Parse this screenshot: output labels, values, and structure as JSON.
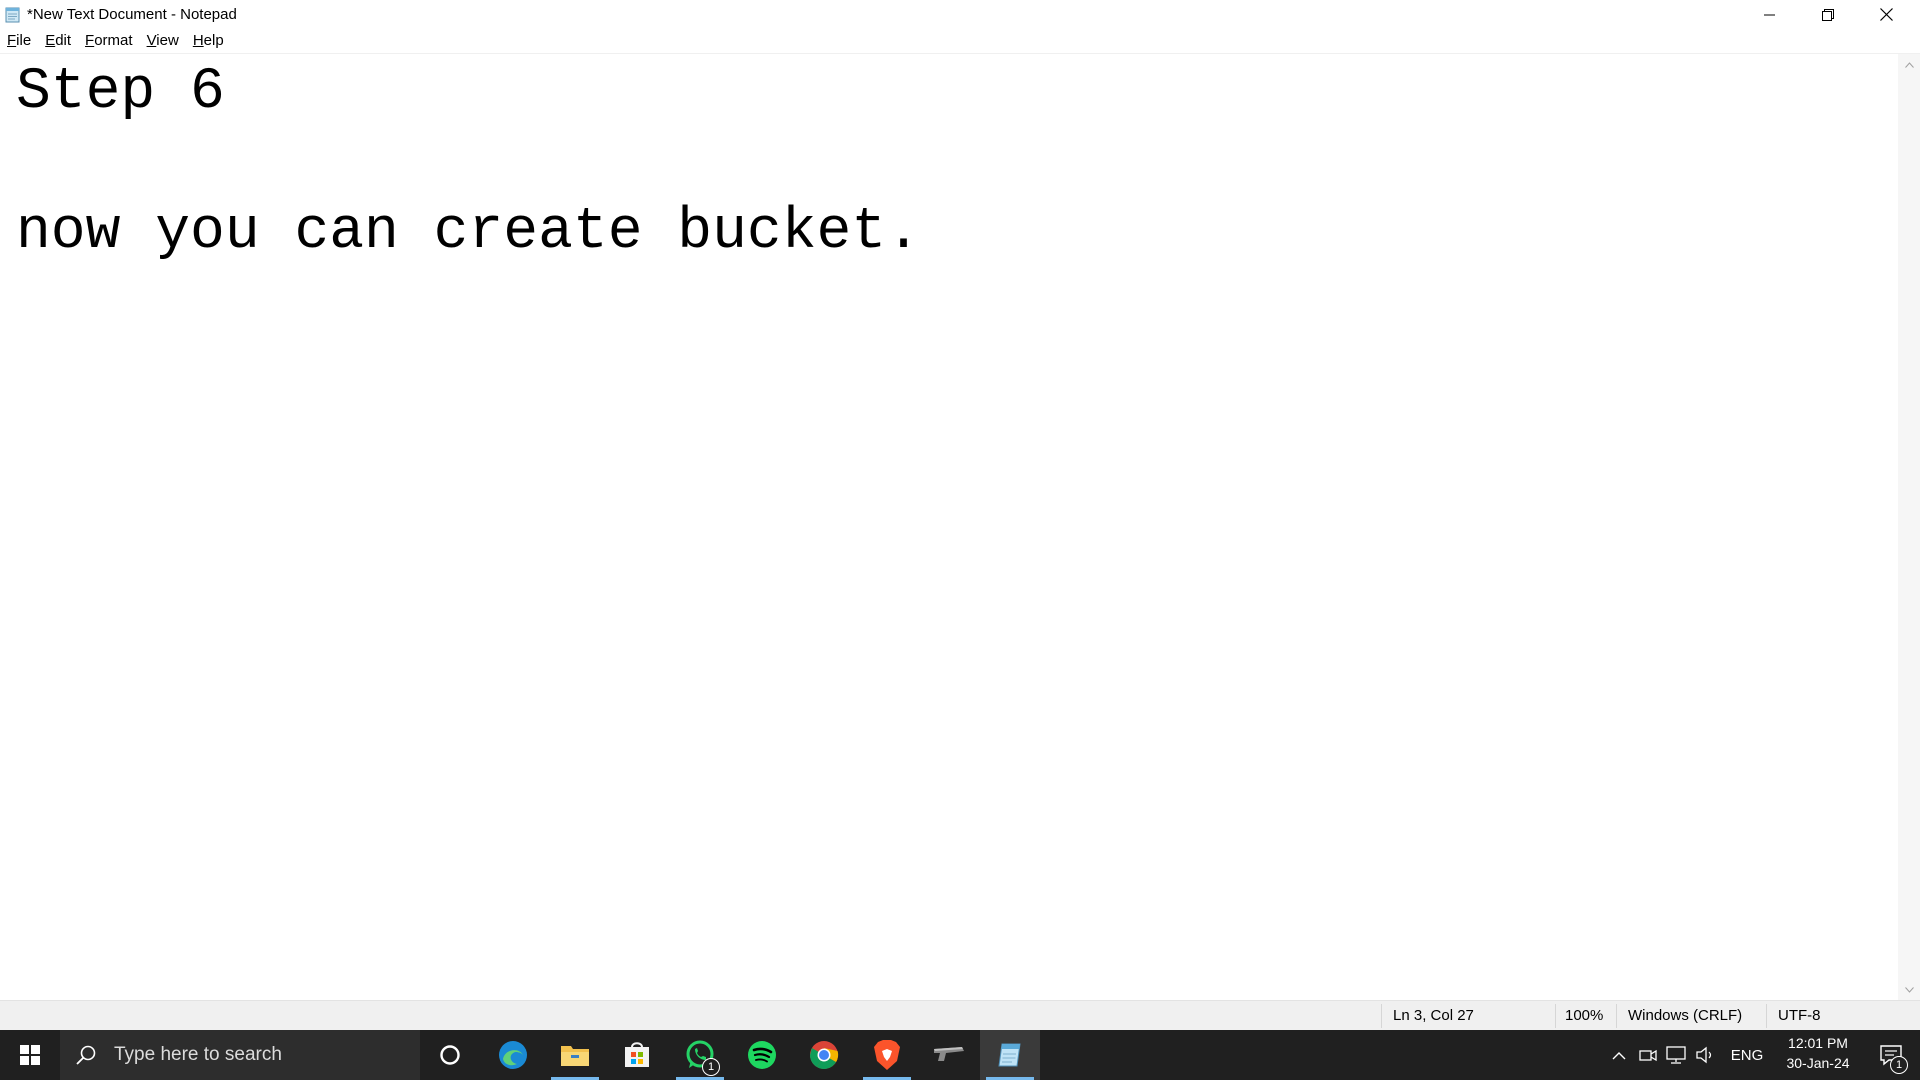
{
  "window": {
    "title": "*New Text Document - Notepad",
    "icon": "notepad-icon"
  },
  "window_controls": [
    "minimize-icon",
    "restore-icon",
    "close-icon"
  ],
  "menu": {
    "items": [
      {
        "accel": "F",
        "rest": "ile"
      },
      {
        "accel": "E",
        "rest": "dit"
      },
      {
        "accel": "F",
        "rest": "ormat"
      },
      {
        "accel": "V",
        "rest": "iew"
      },
      {
        "accel": "H",
        "rest": "elp"
      }
    ]
  },
  "editor": {
    "content": "Step 6\n\nnow you can create bucket."
  },
  "statusbar": {
    "position": "Ln 3, Col 27",
    "zoom": "100%",
    "line_ending": "Windows (CRLF)",
    "encoding": "UTF-8"
  },
  "taskbar": {
    "search_placeholder": "Type here to search",
    "apps": [
      {
        "name": "cortana-icon"
      },
      {
        "name": "edge-icon"
      },
      {
        "name": "file-explorer-icon",
        "running": true
      },
      {
        "name": "microsoft-store-icon"
      },
      {
        "name": "whatsapp-icon",
        "running": true,
        "badge": "1"
      },
      {
        "name": "spotify-icon"
      },
      {
        "name": "chrome-icon"
      },
      {
        "name": "brave-icon",
        "running": true
      },
      {
        "name": "gun-app-icon"
      },
      {
        "name": "notepad-icon",
        "active": true
      }
    ],
    "tray": {
      "language": "ENG",
      "time": "12:01 PM",
      "date": "30-Jan-24",
      "notifications_badge": "1"
    }
  },
  "colors": {
    "taskbar_bg": "#202020",
    "search_bg": "#2d2d2d",
    "accent_underline": "#76b9ed",
    "statusbar_bg": "#f0f0f0"
  }
}
